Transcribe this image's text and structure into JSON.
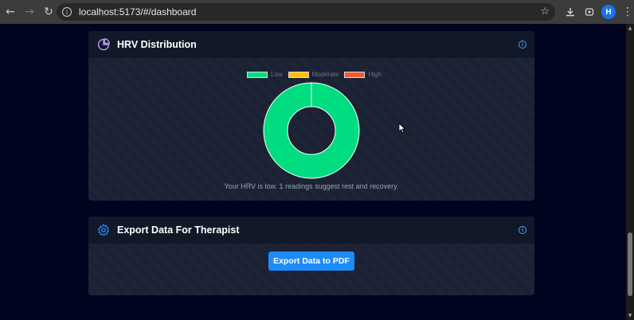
{
  "browser": {
    "url": "localhost:5173/#/dashboard",
    "back_icon": "back-arrow-icon",
    "forward_icon": "forward-arrow-icon",
    "reload_icon": "reload-icon",
    "profile_initial": "H"
  },
  "hrv_card": {
    "title": "HRV Distribution",
    "icon": "pie-chart-icon",
    "legend": [
      {
        "label": "Low",
        "color": "#00dd80"
      },
      {
        "label": "Moderate",
        "color": "#ffc107"
      },
      {
        "label": "High",
        "color": "#ef5a35"
      }
    ],
    "caption": "Your HRV is low. 1 readings suggest rest and recovery."
  },
  "export_card": {
    "title": "Export Data For Therapist",
    "icon": "gear-icon",
    "button_label": "Export Data to PDF"
  },
  "chart_data": {
    "type": "pie",
    "categories": [
      "Low",
      "Moderate",
      "High"
    ],
    "values": [
      1,
      0,
      0
    ],
    "colors": [
      "#00dd80",
      "#ffc107",
      "#ef5a35"
    ],
    "legend_position": "top"
  }
}
